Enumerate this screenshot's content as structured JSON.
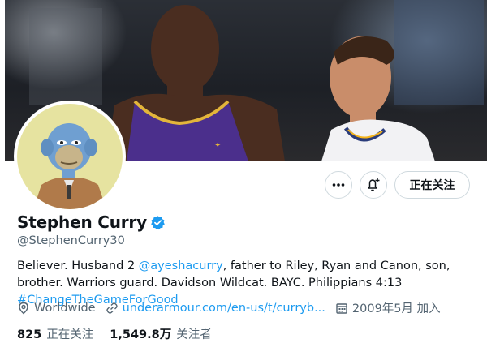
{
  "profile": {
    "name": "Stephen Curry",
    "handle": "@StephenCurry30",
    "verified": true
  },
  "actions": {
    "more_icon": "more-horizontal-icon",
    "notify_icon": "bell-plus-icon",
    "follow_label": "正在关注"
  },
  "bio": {
    "part1": "Believer. Husband 2 ",
    "mention": "@ayeshacurry",
    "part2": ", father to Riley, Ryan and Canon, son, brother. Warriors guard. Davidson Wildcat. BAYC. Philippians 4:13 ",
    "hashtag": "#ChangeTheGameForGood"
  },
  "meta": {
    "location": "Worldwide",
    "website": "underarmour.com/en-us/t/curryb...",
    "joined": "2009年5月 加入"
  },
  "stats": {
    "following_count": "825",
    "following_label": "正在关注",
    "followers_count": "1,549.8万",
    "followers_label": "关注者"
  },
  "colors": {
    "accent": "#1d9bf0",
    "secondary_text": "#536471",
    "avatar_bg": "#e6e3a0",
    "verified": "#1d9bf0"
  }
}
